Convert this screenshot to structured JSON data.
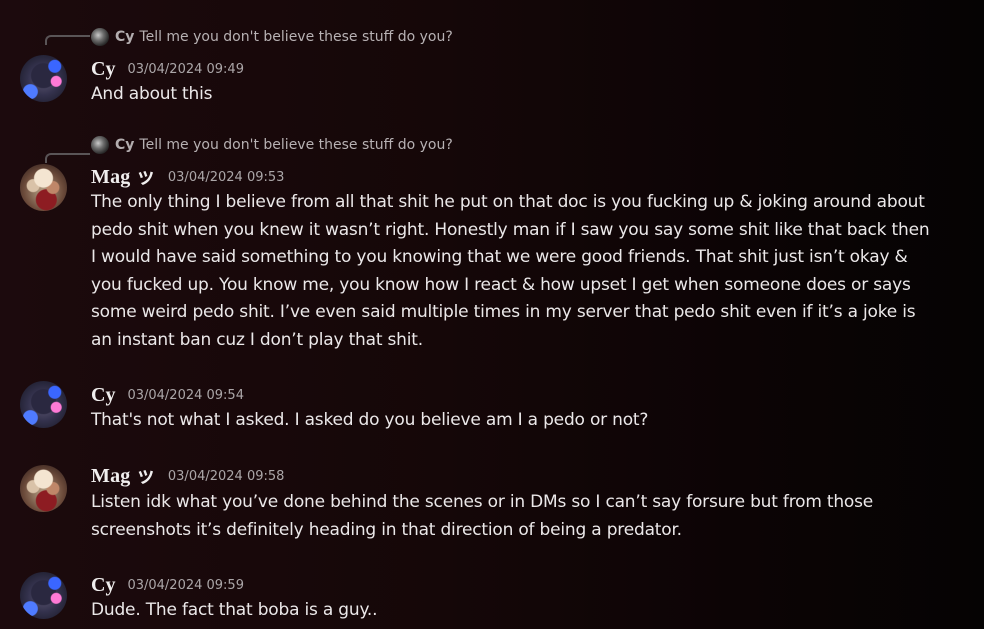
{
  "messages": [
    {
      "reply": {
        "author": "Cy",
        "text": "Tell me you don't believe these stuff do you?"
      },
      "author": "Cy",
      "timestamp": "03/04/2024 09:49",
      "text": "And about this"
    },
    {
      "reply": {
        "author": "Cy",
        "text": "Tell me you don't believe these stuff do you?"
      },
      "author": "Mag ッ",
      "timestamp": "03/04/2024 09:53",
      "text": "The only thing I believe from all that shit he put on that doc is you fucking up & joking around about pedo shit when you knew it wasn’t right. Honestly man if I saw you say some shit like that back then I would have said something to you knowing that we were good friends. That shit just isn’t okay & you fucked up. You know me, you know how I react & how upset I get when someone does or says some weird pedo shit. I’ve even said multiple times in my server that pedo shit even if it’s a joke is an instant ban cuz I don’t play that shit."
    },
    {
      "author": "Cy",
      "timestamp": "03/04/2024 09:54",
      "text": "That's not what I asked. I asked do you believe am I a pedo or not?"
    },
    {
      "author": "Mag ッ",
      "timestamp": "03/04/2024 09:58",
      "text": "Listen idk what you’ve done behind the scenes or in DMs so I can’t say forsure but from those screenshots it’s definitely heading in that direction of being a predator."
    },
    {
      "author": "Cy",
      "timestamp": "03/04/2024 09:59",
      "text": "Dude. The fact that boba is a guy.."
    }
  ]
}
